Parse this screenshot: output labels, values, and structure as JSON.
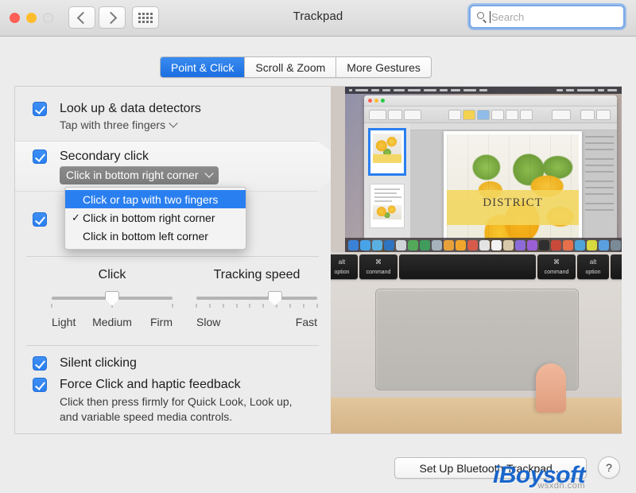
{
  "window": {
    "title": "Trackpad",
    "traffic_lights": [
      "close",
      "minimize",
      "zoom-disabled"
    ],
    "nav": {
      "back": "back-icon",
      "forward": "forward-icon",
      "show_all": "grid-icon"
    }
  },
  "search": {
    "placeholder": "Search",
    "value": "",
    "icon": "search-icon"
  },
  "tabs": [
    {
      "label": "Point & Click",
      "selected": true
    },
    {
      "label": "Scroll & Zoom",
      "selected": false
    },
    {
      "label": "More Gestures",
      "selected": false
    }
  ],
  "options": {
    "look_up": {
      "label": "Look up & data detectors",
      "checked": true,
      "gesture": "Tap with three fingers",
      "chevron": "chevron-down-icon"
    },
    "secondary_click": {
      "label": "Secondary click",
      "checked": true,
      "selected_value": "Click in bottom right corner",
      "chevron": "chevron-down-icon",
      "menu_open": true,
      "menu_items": [
        {
          "label": "Click or tap with two fingers",
          "checked": false,
          "highlighted": true
        },
        {
          "label": "Click in bottom right corner",
          "checked": true,
          "highlighted": false
        },
        {
          "label": "Click in bottom left corner",
          "checked": false,
          "highlighted": false
        }
      ]
    },
    "third_option": {
      "checked": true,
      "label": ""
    },
    "silent_clicking": {
      "label": "Silent clicking",
      "checked": true
    },
    "force_click": {
      "label": "Force Click and haptic feedback",
      "checked": true,
      "description_line1": "Click then press firmly for Quick Look, Look up,",
      "description_line2": "and variable speed media controls."
    }
  },
  "sliders": {
    "click": {
      "title": "Click",
      "labels": [
        "Light",
        "Medium",
        "Firm"
      ],
      "ticks": 3,
      "value_percent": 50
    },
    "tracking_speed": {
      "title": "Tracking speed",
      "labels": [
        "Slow",
        "Fast"
      ],
      "ticks": 10,
      "value_percent": 65
    }
  },
  "preview": {
    "description": "MacBook trackpad photo with finger clicking bottom right corner",
    "document_title": "DISTRICT"
  },
  "bottom": {
    "setup_button": "Set Up Bluetooth Trackpad...",
    "help_button": "?"
  },
  "watermark": {
    "main": "iBoysoft",
    "sub": "wsxdn.com"
  },
  "colors": {
    "accent": "#2a7ff0",
    "tab_selected": "#1a6ee0",
    "popup_button": "#828282",
    "window_bg": "#ececec"
  }
}
